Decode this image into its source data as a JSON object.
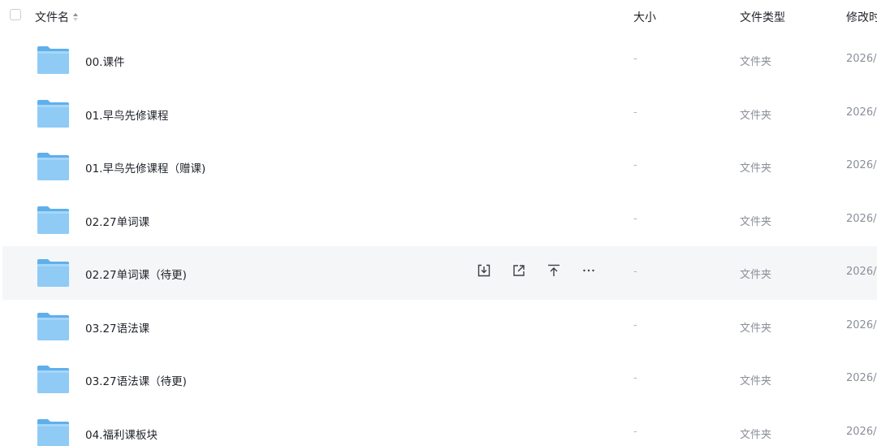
{
  "header": {
    "name": "文件名",
    "size": "大小",
    "type": "文件类型",
    "modified": "修改时"
  },
  "hovered_row_index": 4,
  "row_actions": [
    {
      "name": "download-icon"
    },
    {
      "name": "share-icon"
    },
    {
      "name": "move-to-top-icon"
    },
    {
      "name": "more-icon"
    }
  ],
  "files": [
    {
      "name": "00.课件",
      "size": "-",
      "type": "文件夹",
      "modified": "2026/("
    },
    {
      "name": "01.早鸟先修课程",
      "size": "-",
      "type": "文件夹",
      "modified": "2026/("
    },
    {
      "name": "01.早鸟先修课程（赠课)",
      "size": "-",
      "type": "文件夹",
      "modified": "2026/("
    },
    {
      "name": "02.27单词课",
      "size": "-",
      "type": "文件夹",
      "modified": "2026/("
    },
    {
      "name": "02.27单词课（待更)",
      "size": "-",
      "type": "文件夹",
      "modified": "2026/("
    },
    {
      "name": "03.27语法课",
      "size": "-",
      "type": "文件夹",
      "modified": "2026/("
    },
    {
      "name": "03.27语法课（待更)",
      "size": "-",
      "type": "文件夹",
      "modified": "2026/("
    },
    {
      "name": "04.福利课板块",
      "size": "-",
      "type": "文件夹",
      "modified": "2026/("
    }
  ],
  "colors": {
    "folder_light": "#8fcbf5",
    "folder_dark": "#5eb0ec",
    "hover_bg": "#f5f6f7"
  }
}
